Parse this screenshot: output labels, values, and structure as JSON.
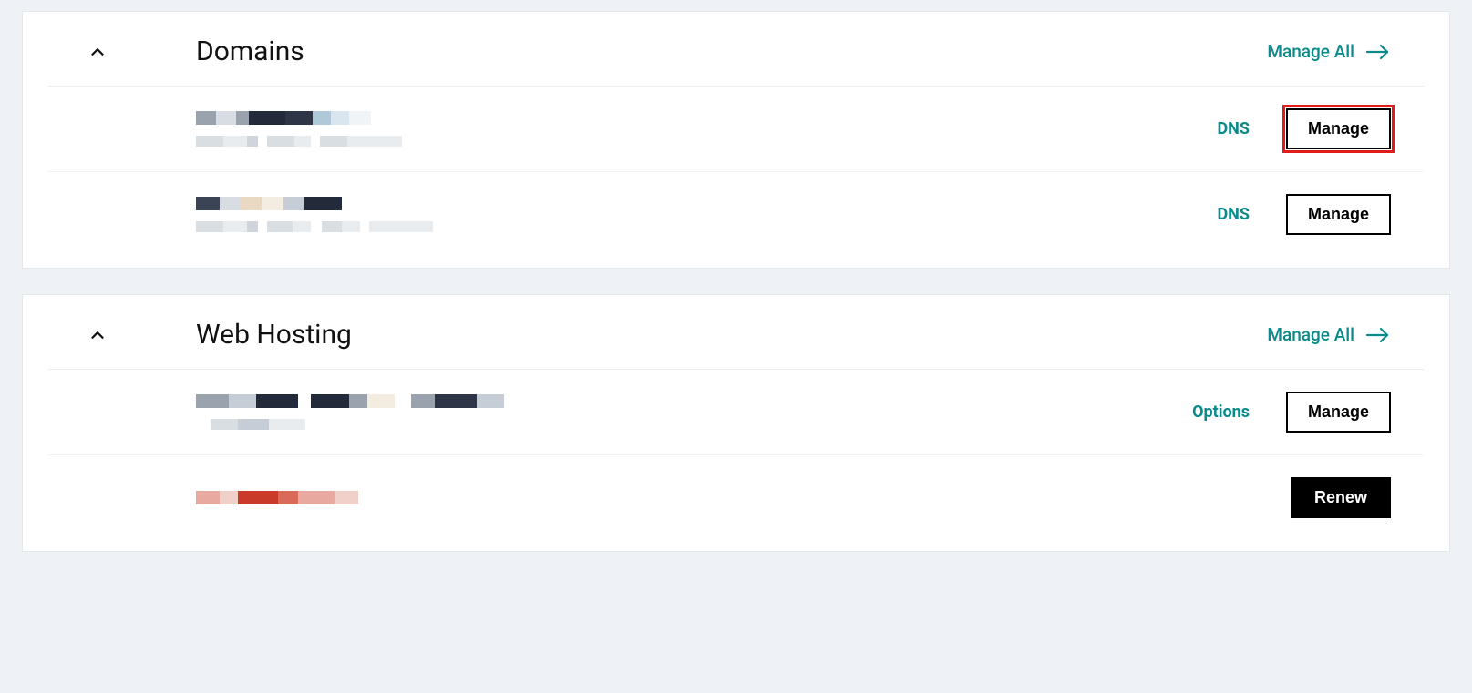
{
  "sections": {
    "domains": {
      "title": "Domains",
      "manage_all_label": "Manage All",
      "items": [
        {
          "dns_label": "DNS",
          "manage_label": "Manage",
          "highlighted": true
        },
        {
          "dns_label": "DNS",
          "manage_label": "Manage",
          "highlighted": false
        }
      ]
    },
    "hosting": {
      "title": "Web Hosting",
      "manage_all_label": "Manage All",
      "items": [
        {
          "options_label": "Options",
          "manage_label": "Manage"
        },
        {
          "renew_label": "Renew"
        }
      ]
    }
  },
  "colors": {
    "accent": "#0a8a8a",
    "highlight": "#e21b1b"
  }
}
